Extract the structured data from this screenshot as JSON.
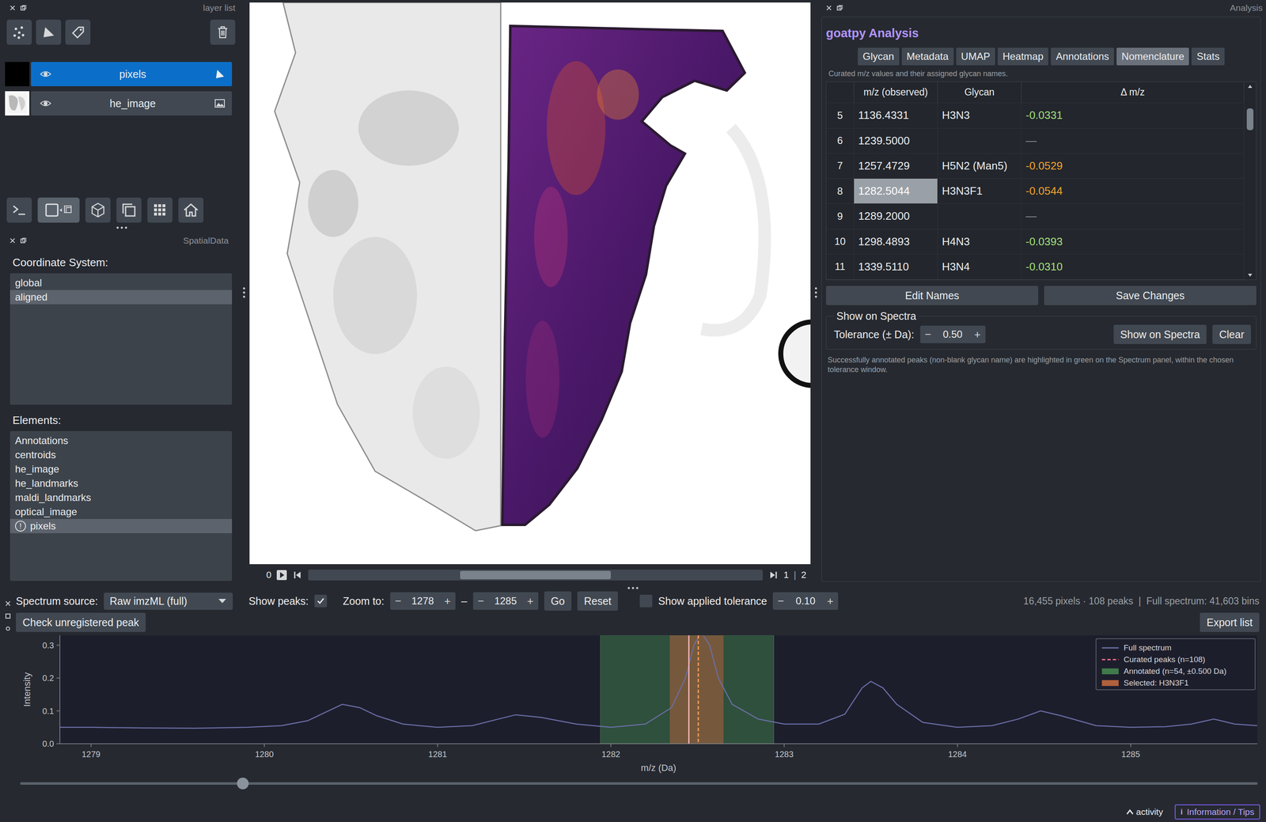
{
  "layer_list": {
    "title": "layer list",
    "layers": [
      {
        "name": "pixels",
        "visible": true,
        "selected": true,
        "kind": "shapes"
      },
      {
        "name": "he_image",
        "visible": true,
        "selected": false,
        "kind": "image"
      }
    ]
  },
  "spatialdata": {
    "title": "SpatialData",
    "coordinate_label": "Coordinate System:",
    "coordinate_systems": [
      {
        "name": "global",
        "selected": false
      },
      {
        "name": "aligned",
        "selected": true
      }
    ],
    "elements_label": "Elements:",
    "warning_icon": "!",
    "elements": [
      {
        "name": "Annotations",
        "selected": false,
        "warning": false
      },
      {
        "name": "centroids",
        "selected": false,
        "warning": false
      },
      {
        "name": "he_image",
        "selected": false,
        "warning": false
      },
      {
        "name": "he_landmarks",
        "selected": false,
        "warning": false
      },
      {
        "name": "maldi_landmarks",
        "selected": false,
        "warning": false
      },
      {
        "name": "optical_image",
        "selected": false,
        "warning": false
      },
      {
        "name": "pixels",
        "selected": true,
        "warning": true
      }
    ]
  },
  "viewer": {
    "slider": {
      "value": "0",
      "level": 0.5,
      "max": "1",
      "separator": "|",
      "total": "2"
    }
  },
  "analysis": {
    "title": "Analysis",
    "heading": "goatpy Analysis",
    "tabs": [
      {
        "label": "Glycan",
        "selected": false
      },
      {
        "label": "Metadata",
        "selected": false
      },
      {
        "label": "UMAP",
        "selected": false
      },
      {
        "label": "Heatmap",
        "selected": false
      },
      {
        "label": "Annotations",
        "selected": false
      },
      {
        "label": "Nomenclature",
        "selected": true
      },
      {
        "label": "Stats",
        "selected": false
      }
    ],
    "note": "Curated m/z values and their assigned glycan names.",
    "table": {
      "columns": [
        "",
        "m/z (observed)",
        "Glycan",
        "Δ m/z"
      ],
      "scroll_level": 0.1,
      "rows": [
        {
          "index": "5",
          "mz": "1136.4331",
          "glycan": "H3N3",
          "delta": "-0.0331",
          "color": "#a3e07c",
          "selected": false
        },
        {
          "index": "6",
          "mz": "1239.5000",
          "glycan": "",
          "delta": "—",
          "color": "#8a8f96",
          "selected": false
        },
        {
          "index": "7",
          "mz": "1257.4729",
          "glycan": "H5N2 (Man5)",
          "delta": "-0.0529",
          "color": "#f3a42c",
          "selected": false
        },
        {
          "index": "8",
          "mz": "1282.5044",
          "glycan": "H3N3F1",
          "delta": "-0.0544",
          "color": "#f3a42c",
          "selected": true
        },
        {
          "index": "9",
          "mz": "1289.2000",
          "glycan": "",
          "delta": "—",
          "color": "#8a8f96",
          "selected": false
        },
        {
          "index": "10",
          "mz": "1298.4893",
          "glycan": "H4N3",
          "delta": "-0.0393",
          "color": "#a3e07c",
          "selected": false
        },
        {
          "index": "11",
          "mz": "1339.5110",
          "glycan": "H3N4",
          "delta": "-0.0310",
          "color": "#a3e07c",
          "selected": false
        }
      ]
    },
    "buttons": [
      "Edit Names",
      "Save Changes"
    ],
    "spectra_group": {
      "title": "Show on Spectra",
      "tolerance_label": "Tolerance (± Da):",
      "tolerance": "0.50",
      "buttons": [
        "Show on Spectra",
        "Clear"
      ]
    },
    "help": "Successfully annotated peaks (non-blank glycan name) are highlighted in green on the Spectrum panel, within the chosen tolerance window."
  },
  "spectrum": {
    "source_label": "Spectrum source:",
    "source": "Raw imzML (full)",
    "show_peaks_label": "Show peaks:",
    "show_peaks": true,
    "zoom_label": "Zoom to:",
    "zoom_from": "1278",
    "zoom_sep": "–",
    "zoom_to": "1285",
    "go": "Go",
    "reset": "Reset",
    "show_tolerance": false,
    "show_tolerance_label": "Show applied tolerance",
    "tolerance": "0.10",
    "status": "16,455 pixels · 108 peaks  |  Full spectrum: 41,603 bins",
    "check_button": "Check unregistered peak",
    "export_button": "Export list",
    "scroll_level": 0.18,
    "chart": {
      "y_label": "Intensity",
      "x_label": "m/z (Da)",
      "y_ticks": [
        "0.0",
        "0.1",
        "0.2",
        "0.3"
      ],
      "x_ticks": [
        "1279",
        "1280",
        "1281",
        "1282",
        "1283",
        "1284",
        "1285"
      ],
      "legend": [
        {
          "label": "Full spectrum",
          "kind": "line",
          "color": "#6a6fa6"
        },
        {
          "label": "Curated peaks (n=108)",
          "kind": "dash",
          "color": "#ff7088"
        },
        {
          "label": "Annotated (n=54, ±0.500 Da)",
          "kind": "band",
          "color": "#3f7a4a"
        },
        {
          "label": "Selected: H3N3F1",
          "kind": "band",
          "color": "#b0603c"
        }
      ],
      "series": [
        {
          "name": "Full spectrum",
          "points": [
            [
              1278.82,
              0.05
            ],
            [
              1279.0,
              0.05
            ],
            [
              1279.3,
              0.048
            ],
            [
              1279.6,
              0.047
            ],
            [
              1279.9,
              0.05
            ],
            [
              1280.1,
              0.055
            ],
            [
              1280.25,
              0.07
            ],
            [
              1280.35,
              0.095
            ],
            [
              1280.45,
              0.12
            ],
            [
              1280.55,
              0.11
            ],
            [
              1280.65,
              0.085
            ],
            [
              1280.8,
              0.06
            ],
            [
              1281.0,
              0.05
            ],
            [
              1281.2,
              0.055
            ],
            [
              1281.35,
              0.075
            ],
            [
              1281.45,
              0.088
            ],
            [
              1281.6,
              0.08
            ],
            [
              1281.8,
              0.06
            ],
            [
              1282.0,
              0.05
            ],
            [
              1282.2,
              0.06
            ],
            [
              1282.35,
              0.11
            ],
            [
              1282.43,
              0.2
            ],
            [
              1282.48,
              0.3
            ],
            [
              1282.52,
              0.34
            ],
            [
              1282.57,
              0.3
            ],
            [
              1282.62,
              0.2
            ],
            [
              1282.7,
              0.12
            ],
            [
              1282.85,
              0.075
            ],
            [
              1283.0,
              0.06
            ],
            [
              1283.2,
              0.06
            ],
            [
              1283.35,
              0.09
            ],
            [
              1283.45,
              0.17
            ],
            [
              1283.5,
              0.19
            ],
            [
              1283.57,
              0.17
            ],
            [
              1283.65,
              0.12
            ],
            [
              1283.8,
              0.065
            ],
            [
              1284.0,
              0.05
            ],
            [
              1284.2,
              0.055
            ],
            [
              1284.35,
              0.075
            ],
            [
              1284.48,
              0.1
            ],
            [
              1284.6,
              0.085
            ],
            [
              1284.8,
              0.055
            ],
            [
              1285.0,
              0.05
            ],
            [
              1285.2,
              0.052
            ],
            [
              1285.35,
              0.06
            ],
            [
              1285.48,
              0.075
            ],
            [
              1285.6,
              0.06
            ],
            [
              1285.73,
              0.055
            ]
          ]
        }
      ],
      "annotated_bands": [
        [
          1281.94,
          1282.94
        ]
      ],
      "selected_band": [
        1282.34,
        1282.65
      ],
      "peak_lines": [
        {
          "mz": 1282.45,
          "color": "#ffb3b3",
          "dashed": false
        },
        {
          "mz": 1282.5044,
          "color": "#ff9a5a",
          "dashed": true
        }
      ]
    }
  },
  "glyphs": {
    "minus": "−",
    "plus": "+"
  },
  "status_bar": {
    "activity": "activity",
    "info_icon": "i",
    "info": "Information / Tips"
  }
}
